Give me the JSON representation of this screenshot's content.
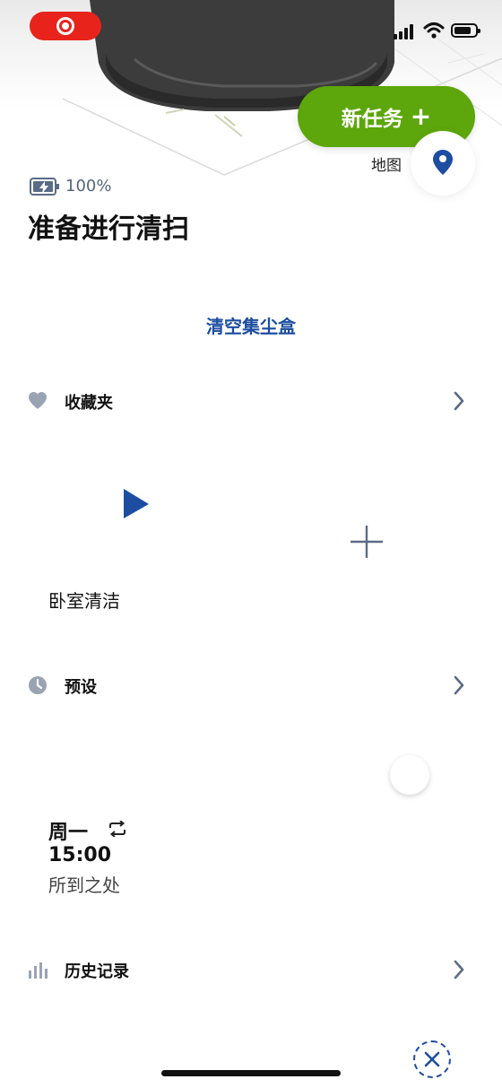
{
  "status_bar": {
    "signal_icon": "cellular-signal-icon",
    "wifi_icon": "wifi-icon",
    "battery_icon": "battery-icon"
  },
  "header": {
    "new_task_label": "新任务",
    "new_task_plus": "+",
    "map_label": "地图",
    "map_icon": "location-pin-icon",
    "accent_green": "#5da60b"
  },
  "robot": {
    "battery_percent": "100%",
    "status": "准备进行清扫",
    "empty_bin_label": "清空集尘盒"
  },
  "favorites": {
    "title": "收藏夹",
    "icon": "heart-icon",
    "items": [
      {
        "name": "卧室清洁"
      }
    ]
  },
  "schedule": {
    "title": "预设",
    "icon": "clock-icon",
    "items": [
      {
        "day": "周一",
        "time": "15:00",
        "area": "所到之处",
        "repeat_icon": "repeat-icon"
      }
    ]
  },
  "history": {
    "title": "历史记录",
    "icon": "bar-chart-icon"
  },
  "colors": {
    "brand_blue": "#1d4da1",
    "icon_gray": "#9aa3b2"
  }
}
